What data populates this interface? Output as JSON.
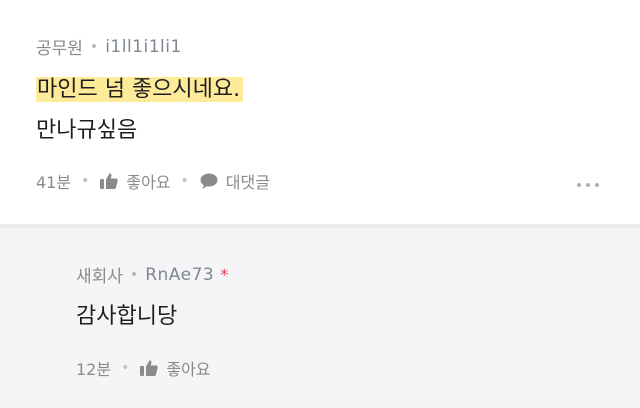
{
  "comments": [
    {
      "company": "공무원",
      "nickname": "i1ll1i1li1",
      "lines": [
        "마인드 넘 좋으시네요.",
        "만나규싶음"
      ],
      "time": "41분",
      "like_label": "좋아요",
      "reply_label": "대댓글"
    },
    {
      "company": "새회사",
      "nickname": "RnAe73",
      "author_mark": "*",
      "lines": [
        "감사합니당"
      ],
      "time": "12분",
      "like_label": "좋아요"
    }
  ],
  "colors": {
    "highlight": "#fdeb9a",
    "author_mark": "#e8384f",
    "reply_background": "#f5f5f7"
  },
  "icons": [
    "thumbs-up-icon",
    "speech-bubble-icon",
    "more-dots-icon"
  ]
}
